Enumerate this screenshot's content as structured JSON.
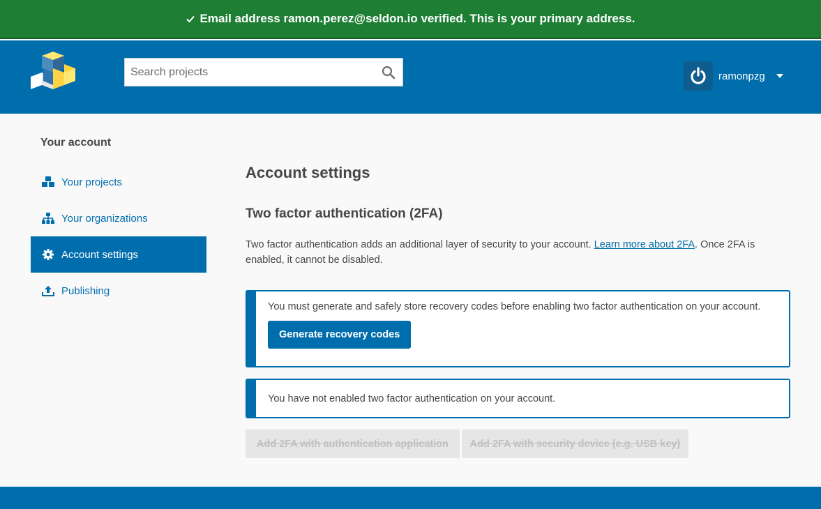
{
  "flash": {
    "message": "Email address ramon.perez@seldon.io verified. This is your primary address.",
    "icon": "check-icon",
    "color": "#1e7e34"
  },
  "header": {
    "color": "#006dad",
    "search": {
      "placeholder": "Search projects",
      "value": ""
    },
    "user": {
      "name": "ramonpzg",
      "avatar_icon": "power-icon"
    }
  },
  "sidebar": {
    "title": "Your account",
    "items": [
      {
        "label": "Your projects",
        "icon": "cubes-icon",
        "active": false
      },
      {
        "label": "Your organizations",
        "icon": "sitemap-icon",
        "active": false
      },
      {
        "label": "Account settings",
        "icon": "gear-icon",
        "active": true
      },
      {
        "label": "Publishing",
        "icon": "upload-icon",
        "active": false
      }
    ]
  },
  "main": {
    "title": "Account settings",
    "section_title": "Two factor authentication (2FA)",
    "desc_before": "Two factor authentication adds an additional layer of security to your account. ",
    "desc_link": "Learn more about 2FA",
    "desc_after": ". Once 2FA is enabled, it cannot be disabled.",
    "callout_recovery": {
      "text": "You must generate and safely store recovery codes before enabling two factor authentication on your account.",
      "button": "Generate recovery codes"
    },
    "callout_status": {
      "text": "You have not enabled two factor authentication on your account."
    },
    "disabled_buttons": {
      "auth_app": "Add 2FA with authentication application",
      "security_device": "Add 2FA with security device (e.g. USB key)"
    }
  }
}
